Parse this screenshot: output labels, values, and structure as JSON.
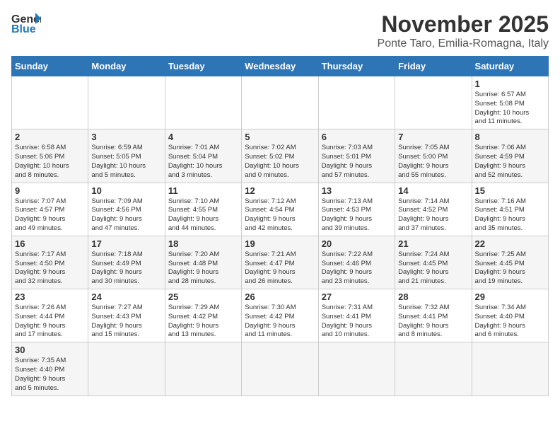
{
  "header": {
    "logo_line1": "General",
    "logo_line2": "Blue",
    "title": "November 2025",
    "subtitle": "Ponte Taro, Emilia-Romagna, Italy"
  },
  "weekdays": [
    "Sunday",
    "Monday",
    "Tuesday",
    "Wednesday",
    "Thursday",
    "Friday",
    "Saturday"
  ],
  "weeks": [
    [
      {
        "day": "",
        "info": ""
      },
      {
        "day": "",
        "info": ""
      },
      {
        "day": "",
        "info": ""
      },
      {
        "day": "",
        "info": ""
      },
      {
        "day": "",
        "info": ""
      },
      {
        "day": "",
        "info": ""
      },
      {
        "day": "1",
        "info": "Sunrise: 6:57 AM\nSunset: 5:08 PM\nDaylight: 10 hours\nand 11 minutes."
      }
    ],
    [
      {
        "day": "2",
        "info": "Sunrise: 6:58 AM\nSunset: 5:06 PM\nDaylight: 10 hours\nand 8 minutes."
      },
      {
        "day": "3",
        "info": "Sunrise: 6:59 AM\nSunset: 5:05 PM\nDaylight: 10 hours\nand 5 minutes."
      },
      {
        "day": "4",
        "info": "Sunrise: 7:01 AM\nSunset: 5:04 PM\nDaylight: 10 hours\nand 3 minutes."
      },
      {
        "day": "5",
        "info": "Sunrise: 7:02 AM\nSunset: 5:02 PM\nDaylight: 10 hours\nand 0 minutes."
      },
      {
        "day": "6",
        "info": "Sunrise: 7:03 AM\nSunset: 5:01 PM\nDaylight: 9 hours\nand 57 minutes."
      },
      {
        "day": "7",
        "info": "Sunrise: 7:05 AM\nSunset: 5:00 PM\nDaylight: 9 hours\nand 55 minutes."
      },
      {
        "day": "8",
        "info": "Sunrise: 7:06 AM\nSunset: 4:59 PM\nDaylight: 9 hours\nand 52 minutes."
      }
    ],
    [
      {
        "day": "9",
        "info": "Sunrise: 7:07 AM\nSunset: 4:57 PM\nDaylight: 9 hours\nand 49 minutes."
      },
      {
        "day": "10",
        "info": "Sunrise: 7:09 AM\nSunset: 4:56 PM\nDaylight: 9 hours\nand 47 minutes."
      },
      {
        "day": "11",
        "info": "Sunrise: 7:10 AM\nSunset: 4:55 PM\nDaylight: 9 hours\nand 44 minutes."
      },
      {
        "day": "12",
        "info": "Sunrise: 7:12 AM\nSunset: 4:54 PM\nDaylight: 9 hours\nand 42 minutes."
      },
      {
        "day": "13",
        "info": "Sunrise: 7:13 AM\nSunset: 4:53 PM\nDaylight: 9 hours\nand 39 minutes."
      },
      {
        "day": "14",
        "info": "Sunrise: 7:14 AM\nSunset: 4:52 PM\nDaylight: 9 hours\nand 37 minutes."
      },
      {
        "day": "15",
        "info": "Sunrise: 7:16 AM\nSunset: 4:51 PM\nDaylight: 9 hours\nand 35 minutes."
      }
    ],
    [
      {
        "day": "16",
        "info": "Sunrise: 7:17 AM\nSunset: 4:50 PM\nDaylight: 9 hours\nand 32 minutes."
      },
      {
        "day": "17",
        "info": "Sunrise: 7:18 AM\nSunset: 4:49 PM\nDaylight: 9 hours\nand 30 minutes."
      },
      {
        "day": "18",
        "info": "Sunrise: 7:20 AM\nSunset: 4:48 PM\nDaylight: 9 hours\nand 28 minutes."
      },
      {
        "day": "19",
        "info": "Sunrise: 7:21 AM\nSunset: 4:47 PM\nDaylight: 9 hours\nand 26 minutes."
      },
      {
        "day": "20",
        "info": "Sunrise: 7:22 AM\nSunset: 4:46 PM\nDaylight: 9 hours\nand 23 minutes."
      },
      {
        "day": "21",
        "info": "Sunrise: 7:24 AM\nSunset: 4:45 PM\nDaylight: 9 hours\nand 21 minutes."
      },
      {
        "day": "22",
        "info": "Sunrise: 7:25 AM\nSunset: 4:45 PM\nDaylight: 9 hours\nand 19 minutes."
      }
    ],
    [
      {
        "day": "23",
        "info": "Sunrise: 7:26 AM\nSunset: 4:44 PM\nDaylight: 9 hours\nand 17 minutes."
      },
      {
        "day": "24",
        "info": "Sunrise: 7:27 AM\nSunset: 4:43 PM\nDaylight: 9 hours\nand 15 minutes."
      },
      {
        "day": "25",
        "info": "Sunrise: 7:29 AM\nSunset: 4:42 PM\nDaylight: 9 hours\nand 13 minutes."
      },
      {
        "day": "26",
        "info": "Sunrise: 7:30 AM\nSunset: 4:42 PM\nDaylight: 9 hours\nand 11 minutes."
      },
      {
        "day": "27",
        "info": "Sunrise: 7:31 AM\nSunset: 4:41 PM\nDaylight: 9 hours\nand 10 minutes."
      },
      {
        "day": "28",
        "info": "Sunrise: 7:32 AM\nSunset: 4:41 PM\nDaylight: 9 hours\nand 8 minutes."
      },
      {
        "day": "29",
        "info": "Sunrise: 7:34 AM\nSunset: 4:40 PM\nDaylight: 9 hours\nand 6 minutes."
      }
    ],
    [
      {
        "day": "30",
        "info": "Sunrise: 7:35 AM\nSunset: 4:40 PM\nDaylight: 9 hours\nand 5 minutes."
      },
      {
        "day": "",
        "info": ""
      },
      {
        "day": "",
        "info": ""
      },
      {
        "day": "",
        "info": ""
      },
      {
        "day": "",
        "info": ""
      },
      {
        "day": "",
        "info": ""
      },
      {
        "day": "",
        "info": ""
      }
    ]
  ]
}
